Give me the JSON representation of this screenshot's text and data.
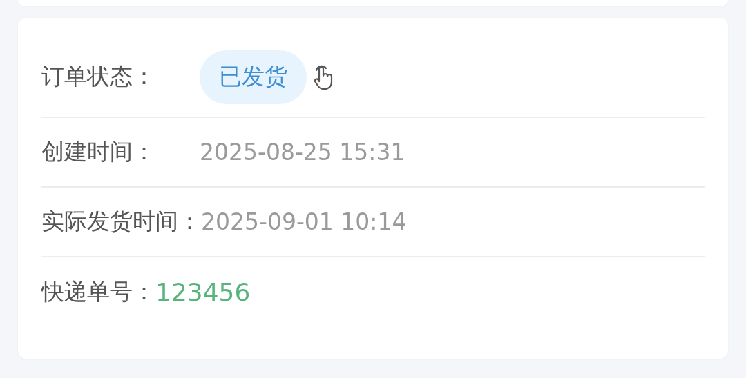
{
  "rows": [
    {
      "kind": "status",
      "label": "订单状态：",
      "value": "已发货"
    },
    {
      "kind": "time",
      "label": "创建时间：",
      "value": "2025-08-25 15:31"
    },
    {
      "kind": "time",
      "label": "实际发货时间：",
      "value": "2025-09-01 10:14"
    },
    {
      "kind": "tracking",
      "label": "快递单号：",
      "value": "123456"
    }
  ]
}
